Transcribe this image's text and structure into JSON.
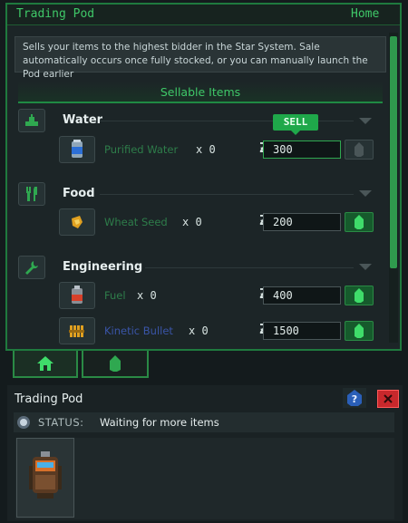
{
  "header": {
    "title": "Trading Pod",
    "home_label": "Home"
  },
  "description": "Sells your items to the highest bidder in the Star System. Sale automatically occurs once fully stocked, or you can manually launch the Pod earlier",
  "list": {
    "title": "Sellable Items",
    "sell_tooltip": "SELL",
    "currency_symbol": "Ƶ",
    "categories": [
      {
        "name": "Water",
        "icon": "water-icon",
        "items": [
          {
            "name": "Purified Water",
            "qty": "x 0",
            "price": "300",
            "name_color": "#2e7d4a",
            "sell_enabled": false
          }
        ]
      },
      {
        "name": "Food",
        "icon": "fork-knife-icon",
        "items": [
          {
            "name": "Wheat Seed",
            "qty": "x 0",
            "price": "200",
            "name_color": "#2e7d4a",
            "sell_enabled": true
          }
        ]
      },
      {
        "name": "Engineering",
        "icon": "wrench-icon",
        "items": [
          {
            "name": "Fuel",
            "qty": "x 0",
            "price": "400",
            "name_color": "#2e7d4a",
            "sell_enabled": true
          },
          {
            "name": "Kinetic Bullet",
            "qty": "x 0",
            "price": "1500",
            "name_color": "#3a55a8",
            "sell_enabled": true
          }
        ]
      }
    ]
  },
  "tabs": [
    {
      "name": "home",
      "icon": "home-icon",
      "active": true
    },
    {
      "name": "pod",
      "icon": "pod-icon",
      "active": false
    }
  ],
  "lower": {
    "title": "Trading Pod",
    "status_label": "STATUS:",
    "status_text": "Waiting for more items"
  },
  "colors": {
    "accent": "#3fc868",
    "panel_border": "#1f7a3e",
    "danger": "#c8282c",
    "help": "#2a5fb8"
  }
}
